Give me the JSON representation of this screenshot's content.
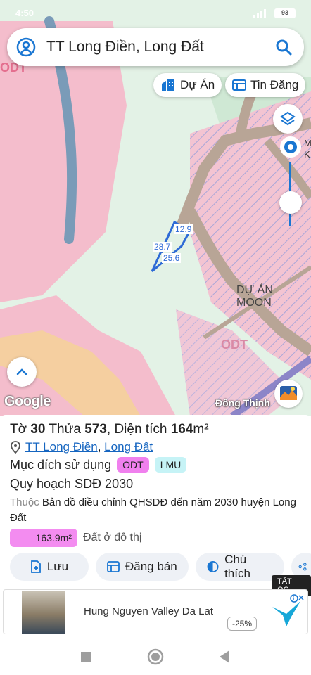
{
  "status": {
    "time": "4:50",
    "battery": "93"
  },
  "search": {
    "value": "TT Long Điền, Long Đất"
  },
  "chips": {
    "du_an": "Dự Án",
    "tin_dang": "Tin Đăng"
  },
  "map": {
    "cut_label_1": "M",
    "cut_label_2": "K",
    "parcel_labels": [
      "12.9",
      "28.7",
      "25.6"
    ],
    "zone_odt_top": "ODT",
    "zone_odt_right": "ODT",
    "project_label": "DỰ ÁN MOON",
    "google_logo": "Google",
    "brand": "Đông Thịnh"
  },
  "parcel": {
    "to_label": "Tờ",
    "to_value": "30",
    "thua_label": "Thửa",
    "thua_value": "573",
    "dien_tich_label": "Diện tích",
    "dien_tich_value": "164",
    "dien_tich_unit": "m²",
    "location_1": "TT Long Điền",
    "location_sep": ", ",
    "location_2": "Long Đất",
    "purpose_label": "Mục đích sử dụng",
    "purpose_tags": [
      "ODT",
      "LMU"
    ],
    "plan_label": "Quy hoạch SDĐ 2030",
    "source_prefix": "Thuộc",
    "source_text": "Bản đồ điều chỉnh QHSDĐ đến năm 2030 huyện Long Đất",
    "area_value": "163.9m²",
    "area_desc": "Đất ở đô thị"
  },
  "actions": {
    "save": "Lưu",
    "post": "Đăng bán",
    "legend": "Chú thích"
  },
  "ad": {
    "label": "TẮT QC",
    "title": "Hung Nguyen Valley Da Lat",
    "discount": "-25%"
  },
  "colors": {
    "odt_pink": "#f4bdcc",
    "lmu_cyan": "#c6f3f6",
    "area_bar": "#f38cf0",
    "link_blue": "#1565c0"
  }
}
